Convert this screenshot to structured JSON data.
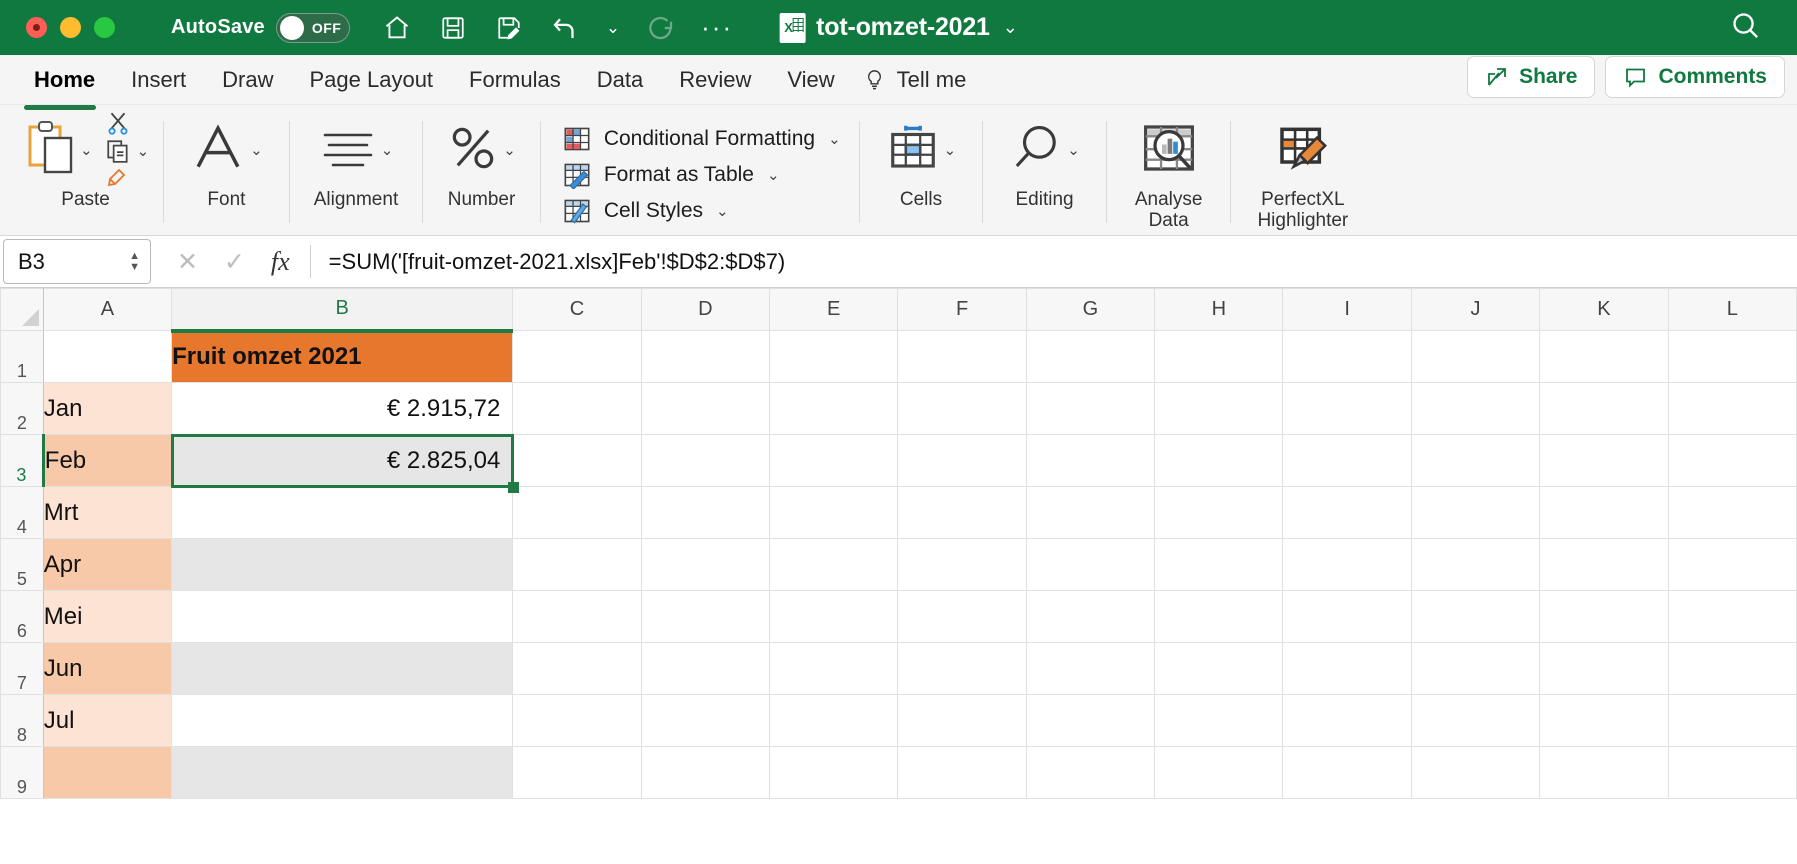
{
  "titlebar": {
    "autosave_label": "AutoSave",
    "autosave_state": "OFF",
    "document_name": "tot-omzet-2021",
    "icons": [
      "home-icon",
      "save-icon",
      "save-as-icon",
      "undo-icon",
      "redo-icon",
      "more-icon",
      "search-icon"
    ],
    "bg_color": "#10793F"
  },
  "tabs": {
    "items": [
      {
        "label": "Home",
        "active": true
      },
      {
        "label": "Insert",
        "active": false
      },
      {
        "label": "Draw",
        "active": false
      },
      {
        "label": "Page Layout",
        "active": false
      },
      {
        "label": "Formulas",
        "active": false
      },
      {
        "label": "Data",
        "active": false
      },
      {
        "label": "Review",
        "active": false
      },
      {
        "label": "View",
        "active": false
      }
    ],
    "tell_me": "Tell me",
    "share": "Share",
    "comments": "Comments"
  },
  "ribbon": {
    "groups": [
      {
        "label": "Paste",
        "name": "paste"
      },
      {
        "label": "Font",
        "name": "font"
      },
      {
        "label": "Alignment",
        "name": "alignment"
      },
      {
        "label": "Number",
        "name": "number"
      },
      {
        "label": "Cells",
        "name": "cells"
      },
      {
        "label": "Editing",
        "name": "editing"
      }
    ],
    "style_items": [
      {
        "label": "Conditional Formatting"
      },
      {
        "label": "Format as Table"
      },
      {
        "label": "Cell Styles"
      }
    ],
    "analyse_data": "Analyse\nData",
    "analyse_line1": "Analyse",
    "analyse_line2": "Data",
    "perfectxl_line1": "PerfectXL",
    "perfectxl_line2": "Highlighter"
  },
  "formula_bar": {
    "name_box": "B3",
    "formula": "=SUM('[fruit-omzet-2021.xlsx]Feb'!$D$2:$D$7)",
    "cancel_icon": "✕",
    "confirm_icon": "✓",
    "fx_label": "fx"
  },
  "grid": {
    "columns": [
      "A",
      "B",
      "C",
      "D",
      "E",
      "F",
      "G",
      "H",
      "I",
      "J",
      "K",
      "L"
    ],
    "selected_column": "B",
    "selected_row": "3",
    "selected_cell": "B3",
    "rows": [
      {
        "num": "1",
        "a": "",
        "b": "Fruit omzet 2021",
        "a_band": "none",
        "b_style": "header"
      },
      {
        "num": "2",
        "a": "Jan",
        "b": "€ 2.915,72",
        "a_band": "light",
        "b_style": "plain"
      },
      {
        "num": "3",
        "a": "Feb",
        "b": "€ 2.825,04",
        "a_band": "dark",
        "b_style": "selected"
      },
      {
        "num": "4",
        "a": "Mrt",
        "b": "",
        "a_band": "light",
        "b_style": "plain"
      },
      {
        "num": "5",
        "a": "Apr",
        "b": "",
        "a_band": "dark",
        "b_style": "gray"
      },
      {
        "num": "6",
        "a": "Mei",
        "b": "",
        "a_band": "light",
        "b_style": "plain"
      },
      {
        "num": "7",
        "a": "Jun",
        "b": "",
        "a_band": "dark",
        "b_style": "gray"
      },
      {
        "num": "8",
        "a": "Jul",
        "b": "",
        "a_band": "light",
        "b_style": "plain"
      },
      {
        "num": "9",
        "a": "",
        "b": "",
        "a_band": "dark",
        "b_style": "gray"
      }
    ],
    "colors": {
      "header_fill": "#E8772E",
      "band_light": "#FCE3D4",
      "band_dark": "#F8C9A8",
      "selection": "#1F7A45",
      "gray_band": "#E6E6E6"
    }
  }
}
